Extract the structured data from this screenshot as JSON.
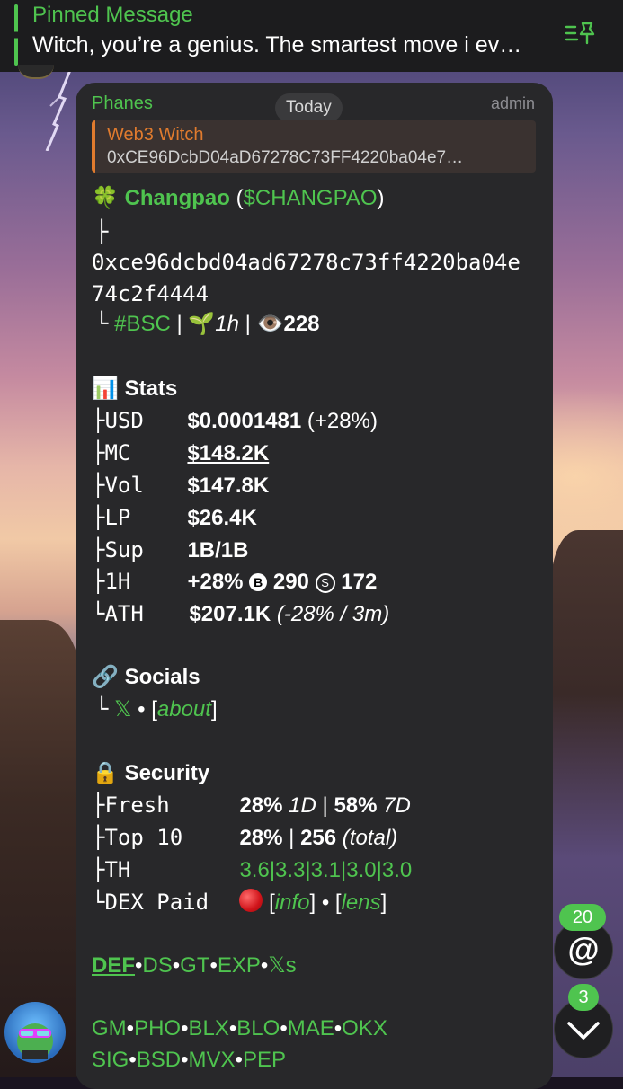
{
  "pinned": {
    "title": "Pinned Message",
    "text": "Witch, you’re a genius. The smartest move i ev…",
    "icon": "pin-list-icon"
  },
  "message": {
    "sender": "Phanes",
    "role": "admin",
    "date_chip": "Today",
    "reply": {
      "name": "Web3 Witch",
      "text": "0xCE96DcbD04aD67278C73FF4220ba04e7…"
    },
    "token": {
      "emoji": "🍀",
      "name": "Changpao",
      "ticker": "$CHANGPAO",
      "open_paren": "(",
      "close_paren": ")",
      "branch": "├",
      "address_line1": "0xce96dcbd04ad67278c73ff4220ba04e",
      "address_line2": "74c2f4444",
      "end": "└",
      "chain": "#BSC",
      "sep": "|",
      "age_emoji": "🌱",
      "age": "1h",
      "views_emoji": "👁️",
      "views": "228"
    },
    "stats": {
      "emoji": "📊",
      "heading": "Stats",
      "rows": [
        {
          "branch": "├",
          "key": "USD",
          "value": "$0.0001481",
          "extra": " (+28%)"
        },
        {
          "branch": "├",
          "key": "MC",
          "value": "$148.2K",
          "extra": ""
        },
        {
          "branch": "├",
          "key": "Vol",
          "value": "$147.8K",
          "extra": ""
        },
        {
          "branch": "├",
          "key": "LP",
          "value": "$26.4K",
          "extra": ""
        },
        {
          "branch": "├",
          "key": "Sup",
          "value": "1B/1B",
          "extra": ""
        }
      ],
      "h1": {
        "branch": "├",
        "key": "1H",
        "value": "+28%",
        "buy_symbol": "B",
        "buys": "290",
        "sell_symbol": "S",
        "sells": "172"
      },
      "ath": {
        "branch": "└",
        "key": "ATH",
        "value": "$207.1K",
        "extra": "(-28% / 3m)"
      }
    },
    "socials": {
      "emoji": "🔗",
      "heading": "Socials",
      "branch": "└",
      "x": "𝕏",
      "dot": "•",
      "lb": "[",
      "about": "about",
      "rb": "]"
    },
    "security": {
      "emoji": "🔒",
      "heading": "Security",
      "fresh": {
        "branch": "├",
        "key": "Fresh",
        "v1": "28%",
        "p1": "1D",
        "sep": "|",
        "v2": "58%",
        "p2": "7D"
      },
      "top10": {
        "branch": "├",
        "key": "Top 10",
        "v1": "28%",
        "sep": "|",
        "v2": "256",
        "note": "(total)"
      },
      "th": {
        "branch": "├",
        "key": "TH",
        "value": "3.6|3.3|3.1|3.0|3.0"
      },
      "dex": {
        "branch": "└",
        "key": "DEX Paid",
        "lb": "[",
        "info": "info",
        "rb": "]",
        "dot": "•",
        "lb2": "[",
        "lens": "lens",
        "rb2": "]"
      }
    },
    "links1": [
      "DEF",
      "DS",
      "GT",
      "EXP",
      "𝕏s"
    ],
    "links2": [
      "GM",
      "PHO",
      "BLX",
      "BLO",
      "MAE",
      "OKX"
    ],
    "links3": [
      "SIG",
      "BSD",
      "MVX",
      "PEP"
    ],
    "link_sep": "•"
  },
  "fab": {
    "mention_badge": "20",
    "mention_symbol": "@",
    "down_badge": "3"
  },
  "colors": {
    "accent": "#4fc44f",
    "reply": "#e07b2e",
    "bubble": "#28282a"
  }
}
